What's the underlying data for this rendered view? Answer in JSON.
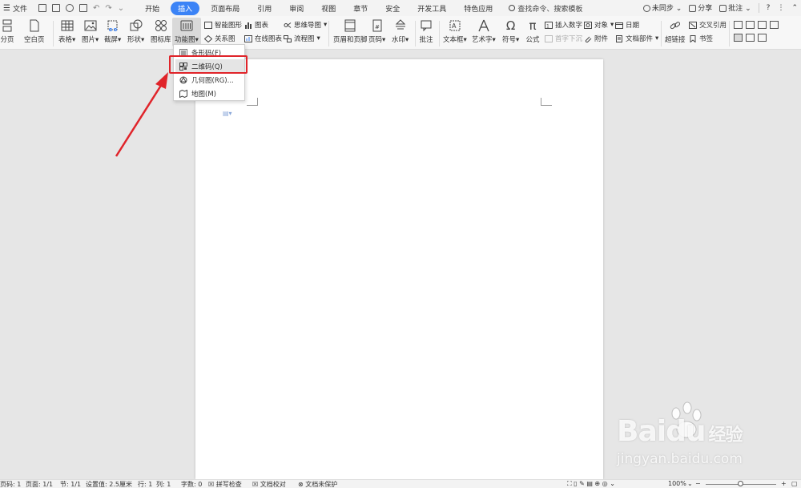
{
  "menu": {
    "label": "文件"
  },
  "tabs": [
    {
      "label": "开始",
      "active": false
    },
    {
      "label": "插入",
      "active": true
    },
    {
      "label": "页面布局",
      "active": false
    },
    {
      "label": "引用",
      "active": false
    },
    {
      "label": "审阅",
      "active": false
    },
    {
      "label": "视图",
      "active": false
    },
    {
      "label": "章节",
      "active": false
    },
    {
      "label": "安全",
      "active": false
    },
    {
      "label": "开发工具",
      "active": false
    },
    {
      "label": "特色应用",
      "active": false
    }
  ],
  "search": {
    "label": "查找命令、搜索模板"
  },
  "topright": {
    "sync": "未同步",
    "share": "分享",
    "comment": "批注",
    "help": "?"
  },
  "ribbon": {
    "page_break": "分页",
    "blank_page": "空白页",
    "table": "表格",
    "picture": "图片",
    "screenshot": "截屏",
    "shape": "形状",
    "icon_library": "图标库",
    "function_chart": "功能图",
    "smart_shape": "智能图形",
    "relation_chart": "关系图",
    "chart": "图表",
    "online_chart": "在线图表",
    "mind_map": "思维导图",
    "flowchart": "流程图",
    "header_footer": "页眉和页脚",
    "page_number": "页码",
    "watermark": "水印",
    "annotation": "批注",
    "textbox": "文本框",
    "wordart": "艺术字",
    "symbol": "符号",
    "formula": "公式",
    "insert_number": "插入数字",
    "drop_cap": "首字下沉",
    "object": "对象",
    "attachment": "附件",
    "date": "日期",
    "doc_parts": "文档部件",
    "hyperlink": "超链接",
    "cross_ref": "交叉引用",
    "bookmark": "书签"
  },
  "dropdown": {
    "items": [
      {
        "label": "条形码(F)"
      },
      {
        "label": "二维码(Q)"
      },
      {
        "label": "几何图(RG)..."
      },
      {
        "label": "地图(M)"
      }
    ]
  },
  "status": {
    "page_code": "页码: 1",
    "page": "页面: 1/1",
    "section": "节: 1/1",
    "setting": "设置值: 2.5厘米",
    "row": "行: 1",
    "col": "列: 1",
    "words": "字数: 0",
    "spell": "拼写检查",
    "doc_check": "文档校对",
    "protect": "文档未保护",
    "zoom": "100%"
  },
  "watermark": {
    "brand": "Baidu",
    "brand_cn": "经验",
    "url": "jingyan.baidu.com"
  },
  "colors": {
    "accent": "#3b83f6",
    "highlight_border": "#e0242a"
  }
}
